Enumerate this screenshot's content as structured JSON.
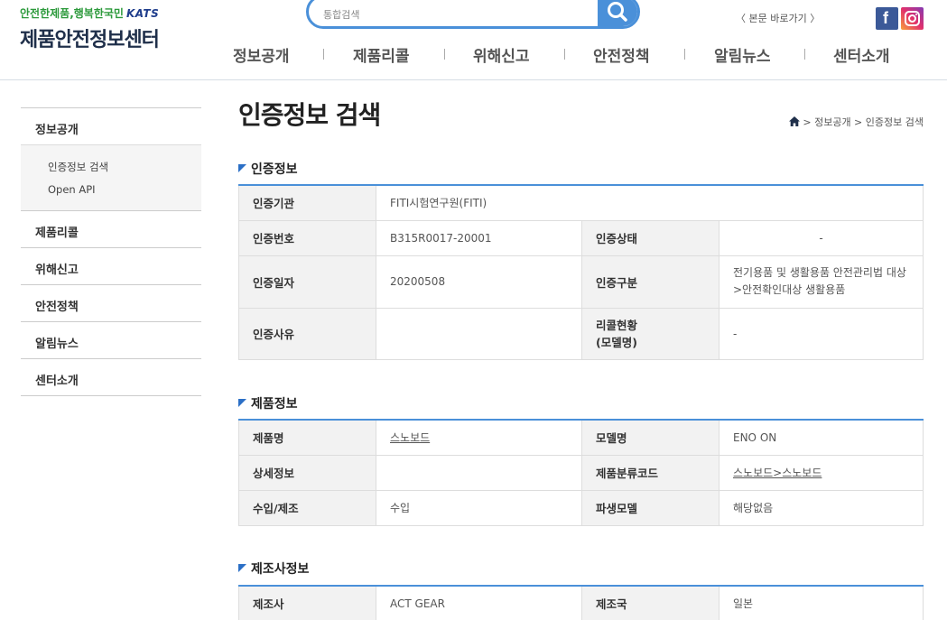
{
  "header": {
    "slogan_green": "안전한제품,",
    "slogan_rest": "행복한국민",
    "brand": "KATS",
    "site_title": "제품안전정보센터",
    "search_placeholder": "통합검색",
    "skip_link": "〈 본문 바로가기 〉",
    "nav": [
      "정보공개",
      "제품리콜",
      "위해신고",
      "안전정책",
      "알림뉴스",
      "센터소개"
    ]
  },
  "sidebar": {
    "items": [
      {
        "label": "정보공개"
      },
      {
        "label": "제품리콜"
      },
      {
        "label": "위해신고"
      },
      {
        "label": "안전정책"
      },
      {
        "label": "알림뉴스"
      },
      {
        "label": "센터소개"
      }
    ],
    "sub_items": [
      "인증정보 검색",
      "Open API"
    ]
  },
  "page": {
    "title": "인증정보 검색",
    "breadcrumb": [
      "정보공개",
      "인증정보 검색"
    ]
  },
  "cert_section": {
    "title": "인증정보",
    "agency_label": "인증기관",
    "agency_value": "FITI시험연구원(FITI)",
    "number_label": "인증번호",
    "number_value": "B315R0017-20001",
    "status_label": "인증상태",
    "status_value": "-",
    "date_label": "인증일자",
    "date_value": "20200508",
    "category_label": "인증구분",
    "category_value_line1": "전기용품 및 생활용품 안전관리법 대상",
    "category_value_line2": ">안전확인대상 생활용품",
    "reason_label": "인증사유",
    "reason_value": "",
    "recall_label_line1": "리콜현황",
    "recall_label_line2": "(모델명)",
    "recall_value": "-"
  },
  "product_section": {
    "title": "제품정보",
    "name_label": "제품명",
    "name_value": "스노보드",
    "model_label": "모델명",
    "model_value": "ENO ON",
    "detail_label": "상세정보",
    "detail_value": "",
    "class_code_label": "제품분류코드",
    "class_code_value": "스노보드>스노보드",
    "import_label": "수입/제조",
    "import_value": "수입",
    "derived_label": "파생모델",
    "derived_value": "해당없음"
  },
  "maker_section": {
    "title": "제조사정보",
    "maker_label": "제조사",
    "maker_value": "ACT GEAR",
    "country_label": "제조국",
    "country_value": "일본"
  },
  "colors": {
    "accent": "#4a90d9",
    "section_marker": "#2b6fc6",
    "header_bg": "#f2f2f2",
    "facebook": "#3b5998"
  },
  "icons": [
    "search-icon",
    "home-icon",
    "facebook-icon",
    "instagram-icon",
    "section-marker-icon"
  ]
}
